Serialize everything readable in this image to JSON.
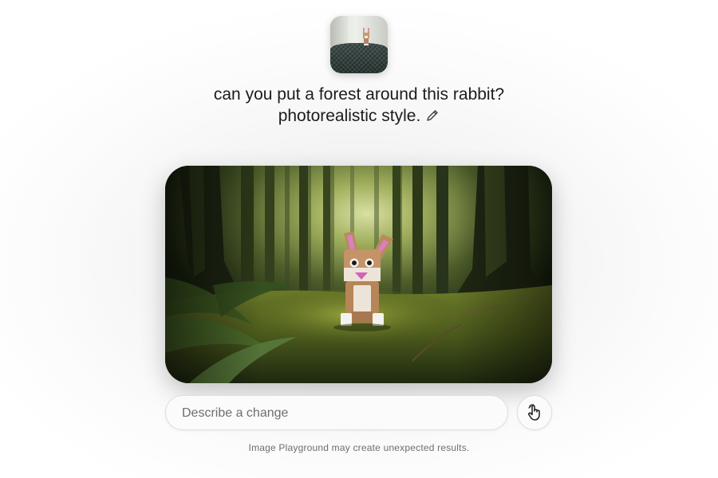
{
  "source_image": {
    "icon": "rabbit-photo-thumbnail"
  },
  "prompt": {
    "line1": "can you put a forest around this rabbit?",
    "line2": "photorealistic style.",
    "edit_icon": "pencil-icon"
  },
  "generated_image": {
    "subject": "toy rabbit in a mossy forest"
  },
  "input": {
    "placeholder": "Describe a change",
    "value": ""
  },
  "action_button": {
    "icon": "hand-pointer-icon"
  },
  "footer": {
    "disclaimer": "Image Playground may create unexpected results."
  },
  "colors": {
    "text": "#1c1c1e",
    "secondary_text": "#6e6e73",
    "forest_dark": "#1f2a14",
    "moss": "#6f7d2a"
  }
}
